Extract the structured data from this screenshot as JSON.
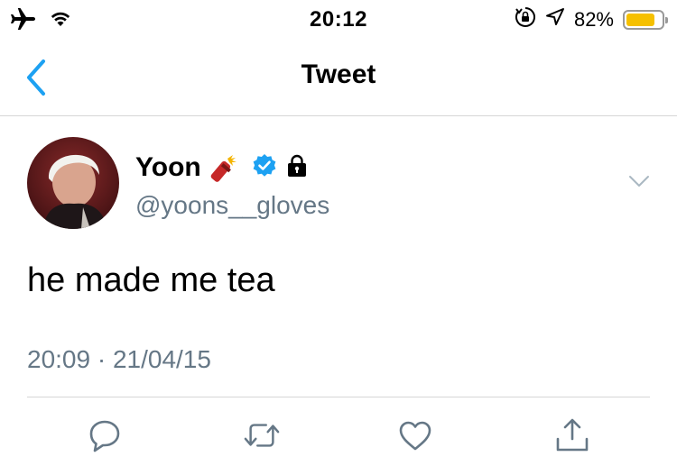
{
  "status_bar": {
    "time": "20:12",
    "battery_percent_label": "82%",
    "battery_level": 0.82,
    "battery_color": "#f5c000",
    "left_icons": [
      "airplane-icon",
      "wifi-icon"
    ],
    "right_icons": [
      "rotation-lock-icon",
      "location-icon",
      "battery-icon"
    ]
  },
  "navbar": {
    "title": "Tweet",
    "back_icon": "chevron-left-icon",
    "accent_color": "#1da1f2"
  },
  "tweet": {
    "author": {
      "name": "Yoon",
      "handle": "@yoons__gloves",
      "badges": [
        "firecracker-emoji",
        "verified-icon",
        "lock-icon"
      ]
    },
    "text": "he made me tea",
    "timestamp": "20:09 · 21/04/15"
  },
  "actions": [
    "reply-icon",
    "retweet-icon",
    "like-icon",
    "share-icon"
  ]
}
